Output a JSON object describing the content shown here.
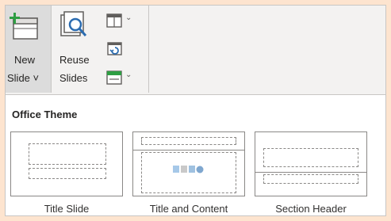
{
  "ribbon": {
    "new_slide": {
      "line1": "New",
      "line2": "Slide ˅"
    },
    "reuse_slides": {
      "line1": "Reuse",
      "line2": "Slides"
    }
  },
  "gallery": {
    "title": "Office Theme",
    "layouts": [
      {
        "label": "Title Slide"
      },
      {
        "label": "Title and Content"
      },
      {
        "label": "Section Header"
      }
    ]
  },
  "colors": {
    "accent_green": "#2e9e43",
    "accent_blue": "#2b6cb0",
    "background": "#fde4cf"
  }
}
